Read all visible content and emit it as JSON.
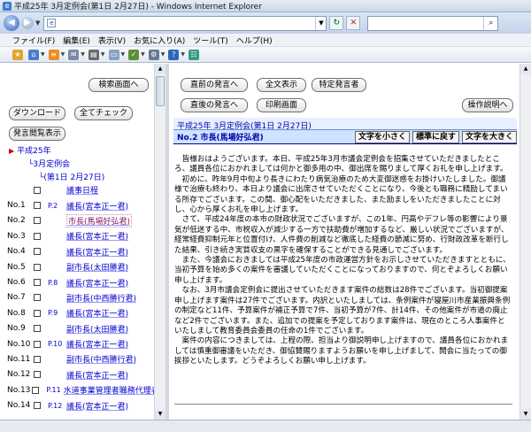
{
  "window": {
    "title": "平成25年 3月定例会(第1日 2月27日) - Windows Internet Explorer"
  },
  "address": {
    "url": "e"
  },
  "menu": [
    "ファイル(F)",
    "編集(E)",
    "表示(V)",
    "お気に入り(A)",
    "ツール(T)",
    "ヘルプ(H)"
  ],
  "left": {
    "search_button": "検索画面へ",
    "download_button": "ダウンロード",
    "check_all_button": "全てチェック",
    "speaker_list_button": "発言閲覧表示",
    "tree_root": "平成25年",
    "tree_session": "3月定例会",
    "tree_day": "(第1日 2月27日)",
    "rows": [
      {
        "no": "",
        "page": "",
        "speaker": "議事日程"
      },
      {
        "no": "No.1",
        "page": "P.2",
        "speaker": "議長(宮本正一君)"
      },
      {
        "no": "No.2",
        "page": "",
        "speaker": "市長(馬場好弘君)",
        "selected": true
      },
      {
        "no": "No.3",
        "page": "",
        "speaker": "議長(宮本正一君)"
      },
      {
        "no": "No.4",
        "page": "",
        "speaker": "議長(宮本正一君)"
      },
      {
        "no": "No.5",
        "page": "",
        "speaker": "副市長(太田勝君)"
      },
      {
        "no": "No.6",
        "page": "P.8",
        "speaker": "議長(宮本正一君)"
      },
      {
        "no": "No.7",
        "page": "",
        "speaker": "副市長(中西勝行君)"
      },
      {
        "no": "No.8",
        "page": "P.9",
        "speaker": "議長(宮本正一君)"
      },
      {
        "no": "No.9",
        "page": "",
        "speaker": "副市長(太田勝君)"
      },
      {
        "no": "No.10",
        "page": "P.10",
        "speaker": "議長(宮本正一君)"
      },
      {
        "no": "No.11",
        "page": "",
        "speaker": "副市長(中西勝行君)"
      },
      {
        "no": "No.12",
        "page": "",
        "speaker": "議長(宮本正一君)"
      },
      {
        "no": "No.13",
        "page": "P.11",
        "speaker": "水道事業管理者職務代理者("
      },
      {
        "no": "No.14",
        "page": "P.12",
        "speaker": "議長(宮本正一君)"
      }
    ]
  },
  "right": {
    "prev_speech_button": "直前の発言へ",
    "full_view_button": "全文表示",
    "specific_speaker_button": "特定発言者",
    "next_speech_button": "直後の発言へ",
    "print_button": "印刷画面",
    "help_button": "操作説明へ",
    "doc_title": "平成25年 3月定例会(第1日 2月27日)",
    "speaker_heading": "No.2 市長(馬場好弘君)",
    "font_smaller": "文字を小さく",
    "font_normal": "標準に戻す",
    "font_larger": "文字を大きく",
    "speech": [
      "皆様おはようございます。本日、平成25年3月市議会定例会を招集させていただきましたところ、議員各位におかれましては何かと御多用の中、御出席を賜りまして厚くお礼を申し上げます。",
      "初めに、昨年9月中旬より長きにわたり病気治療のため大変御迷惑をお掛けいたしました。御議様で治療も終わり、本日より議会に出席させていただくことになり、今後とも職務に精励してまいる所存でございます。この間、御心配をいただきました、また励ましをいただきましたことに対し、心から厚くお礼を申し上げます。",
      "さて、平成24年度の本市の財政状況でございますが、この1年、円高やデフレ等の影響により景気が低迷する中、市税収入が減少する一方で扶助費が増加するなど、厳しい状況でございますが、経常経費抑制元年と位置付け、人件費の削減など徹底した経費の節減に努め、行財政改革を断行した結果、引き続き実質収支の黒字を確保することができる見通しでございます。",
      "また、今議会におきましては平成25年度の市政運営方針をお示しさせていただきますとともに、当初予算を始め多くの案件を審議していただくことになっておりますので、何とぞよろしくお願い申し上げます。",
      "なお、3月市議会定例会に提出させていただきます案件の総数は28件でございます。当初御提案申し上げます案件は27件でございます。内訳といたしましては、条例案件が寝屋川市産業振興条例の制定など11件、予算案件が補正予算で7件、当初予算が7件、計14件、その他案件が市道の廃止など2件でございます。また、追加での提案を予定しております案件は、現在のところ人事案件といたしまして教育委員会委員の任命の1件でございます。",
      "案件の内容につきましては、上程の際、担当より御説明申し上げますので、議員各位におかれましては慎重御審議をいただき、御協賛賜りますようお願いを申し上げまして、開会に当たっての御挨拶といたします。どうぞよろしくお願い申し上げます。"
    ]
  }
}
